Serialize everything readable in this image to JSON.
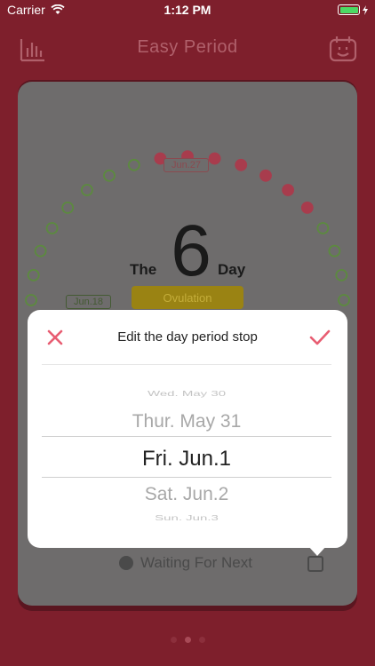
{
  "status_bar": {
    "carrier": "Carrier",
    "time": "1:12 PM"
  },
  "nav": {
    "title": "Easy Period",
    "left_icon": "bar-chart-icon",
    "right_icon": "calendar-face-icon"
  },
  "cycle": {
    "prefix": "The",
    "day_number": "6",
    "suffix": "Day",
    "phase": "Ovulation",
    "peak_date": "Jun.27",
    "start_date": "Jun.18"
  },
  "footer": {
    "waiting_text": "Waiting For Next"
  },
  "dialog": {
    "title": "Edit the day period stop",
    "close_icon": "close-x-icon",
    "confirm_icon": "checkmark-icon",
    "picker": {
      "items": [
        "Wed. May 30",
        "Thur. May 31",
        "Fri. Jun.1",
        "Sat. Jun.2",
        "Sun. Jun.3"
      ],
      "selected": "Fri. Jun.1"
    }
  },
  "pager": {
    "count": 3,
    "active": 1
  },
  "colors": {
    "background": "#7e1f2c",
    "accent": "#e85d72",
    "green_dot": "#5c8a3f",
    "red_dot": "#a83c4d",
    "phase_badge": "#9a8313"
  }
}
